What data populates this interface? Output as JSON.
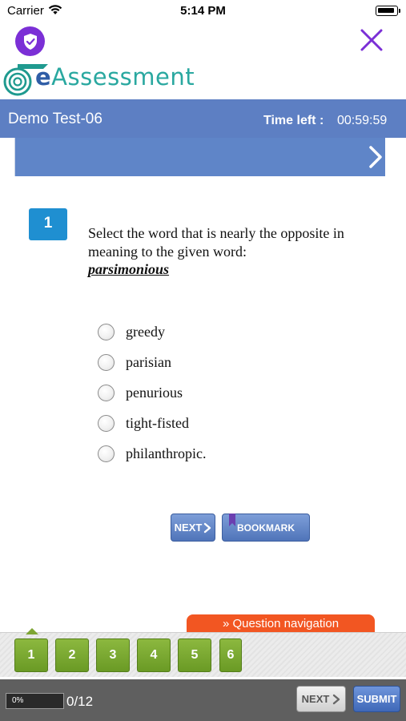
{
  "status_bar": {
    "carrier": "Carrier",
    "time": "5:14 PM"
  },
  "header": {
    "logo_prefix": "e",
    "logo_text": "Assessment",
    "shield_icon": "shield-check-icon",
    "close_icon": "close-x-icon"
  },
  "test": {
    "title": "Demo Test-06",
    "time_label": "Time left :",
    "time_value": "00:59:59"
  },
  "question": {
    "number": "1",
    "text": "Select the word that is nearly the opposite in meaning to the given word:",
    "word": "parsimonious",
    "options": [
      "greedy",
      "parisian",
      "penurious",
      "tight-fisted",
      "philanthropic."
    ]
  },
  "actions": {
    "next_label": "NEXT",
    "bookmark_label": "BOOKMARK"
  },
  "navigation": {
    "tab_label": "» Question navigation",
    "questions": [
      "1",
      "2",
      "3",
      "4",
      "5",
      "6"
    ]
  },
  "footer": {
    "progress_text": "0%",
    "progress_fraction": 0,
    "progress_count": "0/12",
    "next_label": "NEXT",
    "submit_label": "SUBMIT"
  },
  "colors": {
    "accent_blue": "#5d7fc3",
    "question_badge": "#1f8fd1",
    "nav_tab": "#f25622",
    "nav_green": "#7ea534",
    "brand_purple": "#7b2fd6"
  }
}
